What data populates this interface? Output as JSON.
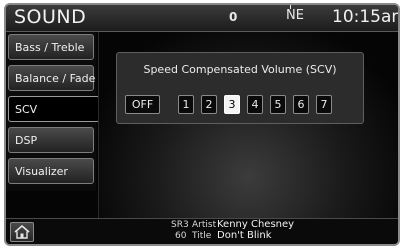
{
  "header": {
    "title": "SOUND",
    "indicator": "0",
    "compass": "NE",
    "time": "10:15am"
  },
  "sidebar": {
    "items": [
      {
        "label": "Bass / Treble",
        "active": false
      },
      {
        "label": "Balance / Fade",
        "active": false
      },
      {
        "label": "SCV",
        "active": true
      },
      {
        "label": "DSP",
        "active": false
      },
      {
        "label": "Visualizer",
        "active": false
      }
    ]
  },
  "scv": {
    "title": "Speed Compensated Volume (SCV)",
    "options": [
      "OFF",
      "1",
      "2",
      "3",
      "4",
      "5",
      "6",
      "7"
    ],
    "selected": "3"
  },
  "now_playing": {
    "line1_preset": "SR3",
    "line1_field": "Artist",
    "artist": "Kenny Chesney",
    "line2_preset": "60",
    "line2_field": "Title",
    "title": "Don't Blink"
  },
  "icons": {
    "home": "home-icon"
  }
}
